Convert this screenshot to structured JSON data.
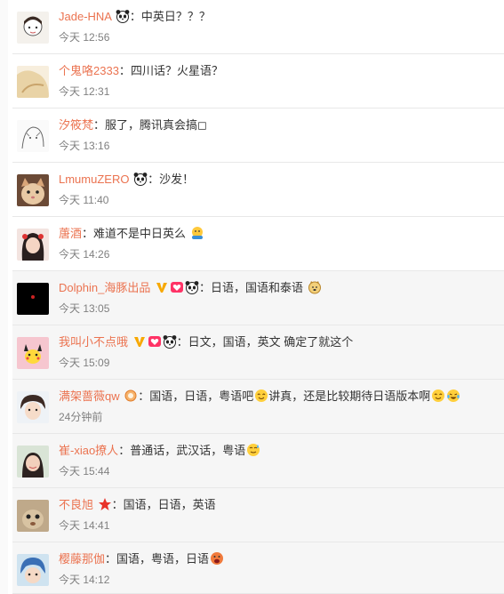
{
  "comments": [
    {
      "user": "Jade-HNA",
      "sep": "：",
      "text": "中英日？？？",
      "time": "今天 12:56"
    },
    {
      "user": "个鬼咯2333",
      "sep": "：",
      "text": "四川话？火星语？",
      "time": "今天 12:31"
    },
    {
      "user": "汐筱梵",
      "sep": "：",
      "text": "服了，腾讯真会搞◻",
      "time": "今天 13:16"
    },
    {
      "user": "LmumuZERO",
      "sep": "：",
      "text": "沙发！",
      "time": "今天 11:40"
    },
    {
      "user": "蓎酒",
      "sep": "：",
      "text": "难道不是中日英么",
      "time": "今天 14:26"
    },
    {
      "user": "Dolphin_海豚出品",
      "sep": "：",
      "text": "日语，国语和泰语",
      "time": "今天 13:05"
    },
    {
      "user": "我叫小不点哦",
      "sep": "：",
      "text": "日文，国语，英文 确定了就这个",
      "time": "今天 15:09"
    },
    {
      "user": "满架蔷薇qw",
      "sep": "：",
      "text": "国语，日语，粤语吧",
      "text2": "讲真，还是比较期待日语版本啊",
      "time": "24分钟前"
    },
    {
      "user": "崔-xiao撩人",
      "sep": "：",
      "text": "普通话，武汉话，粤语",
      "time": "今天 15:44"
    },
    {
      "user": "不良旭",
      "sep": "：",
      "text": "国语，日语，英语",
      "time": "今天 14:41"
    },
    {
      "user": "樱藤那伽",
      "sep": "：",
      "text": "国语，粤语，日语",
      "time": "今天 14:12"
    }
  ],
  "colors": {
    "username": "#eb7350",
    "time": "#808080",
    "text": "#333333",
    "vip": "#f7a800"
  },
  "icons": [
    "panda-icon",
    "hug-emoji",
    "vip-v-icon",
    "heart-badge-icon",
    "laugh-emoji",
    "smile-emoji",
    "cry-laugh-emoji",
    "star-badge-icon",
    "sweat-emoji",
    "medal-icon",
    "doge-emoji",
    "shocked-emoji"
  ]
}
